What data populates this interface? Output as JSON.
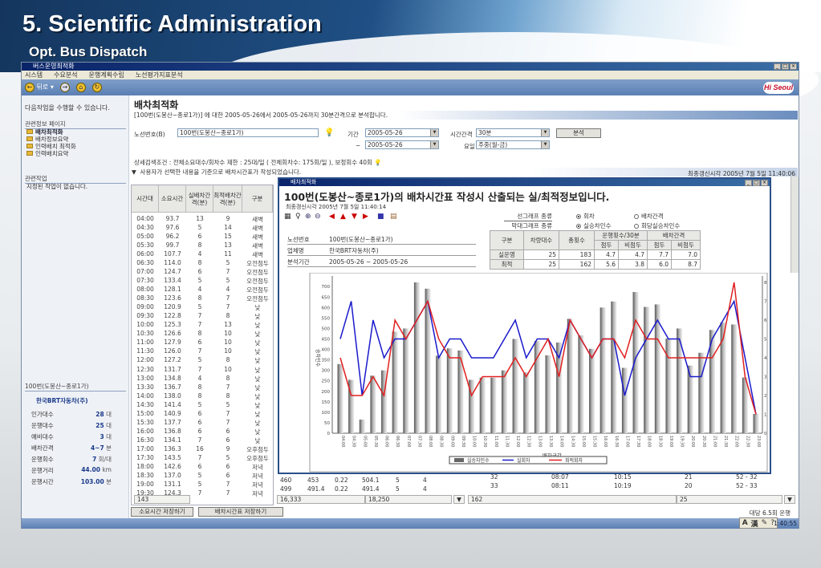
{
  "slide": {
    "title": "5. Scientific Administration",
    "subtitle": "Opt.  Bus Dispatch"
  },
  "window": {
    "title": "버스운영최적화",
    "menu": [
      "시스템",
      "수요분석",
      "운행계획수립",
      "노선평가지표분석"
    ],
    "toolbar": {
      "back": "뒤로"
    },
    "logo": "Hi Seoul"
  },
  "left_panel": {
    "prompt": "다음작업을 수행할 수 있습니다.",
    "related_pages_header": "관련정보 페이지",
    "related_pages": [
      "배차최적화",
      "배차정보요약",
      "인력배치 최적화",
      "인력배치요약"
    ],
    "related_tasks_header": "관련작업",
    "related_tasks_text": "지정된 작업이 없습니다.",
    "route": "100번(도봉산~종로1가)",
    "company": "한국BRT자동차(주)",
    "stats": [
      {
        "label": "인가대수",
        "value": "28",
        "unit": "대"
      },
      {
        "label": "운행대수",
        "value": "25",
        "unit": "대"
      },
      {
        "label": "예비대수",
        "value": "3",
        "unit": "대"
      },
      {
        "label": "배차간격",
        "value": "4~7",
        "unit": "분"
      },
      {
        "label": "운행회수",
        "value": "7",
        "unit": "회/대"
      },
      {
        "label": "운행거리",
        "value": "44.00",
        "unit": "km"
      },
      {
        "label": "운행시간",
        "value": "103.00",
        "unit": "분"
      }
    ]
  },
  "main": {
    "title": "배차최적화",
    "description": "[100번(도봉산~종로1가)] 에 대한 2005-05-26에서 2005-05-26까지 30분간격으로 분석합니다.",
    "route_label": "노선번호(B)",
    "route_value": "100번(도봉산~종로1가)",
    "period_label": "기간",
    "period_from": "2005-05-26",
    "tilde": "~",
    "period_to": "2005-05-26",
    "interval_label": "시간간격",
    "interval_value": "30분",
    "day_label": "요일",
    "day_value": "주중(월-금)",
    "analyze_button": "분석",
    "conditions": "상세검색조건 :  전체소요대수/회차수 제한 : 25대/일 ( 전체회차수: 175회/일 ), 보정회수 40회",
    "notice": "사용자가 선택한 내용을 기준으로 배차시간표가 작성되었습니다.",
    "last_update": "최종갱신시각  2005년 7월 5일 11:40:06",
    "table": {
      "headers": [
        "시간대",
        "소요시간",
        "실배차간격(분)",
        "최적배차간격(분)",
        "구분"
      ],
      "rows": [
        [
          "04:00",
          "93.7",
          "13",
          "9",
          "새벽"
        ],
        [
          "04:30",
          "97.6",
          "5",
          "14",
          "새벽"
        ],
        [
          "05:00",
          "96.2",
          "6",
          "15",
          "새벽"
        ],
        [
          "05:30",
          "99.7",
          "8",
          "13",
          "새벽"
        ],
        [
          "06:00",
          "107.7",
          "4",
          "11",
          "새벽"
        ],
        [
          "06:30",
          "114.0",
          "8",
          "5",
          "오전첨두"
        ],
        [
          "07:00",
          "124.7",
          "6",
          "7",
          "오전첨두"
        ],
        [
          "07:30",
          "133.4",
          "5",
          "5",
          "오전첨두"
        ],
        [
          "08:00",
          "128.1",
          "4",
          "4",
          "오전첨두"
        ],
        [
          "08:30",
          "123.6",
          "8",
          "7",
          "오전첨두"
        ],
        [
          "09:00",
          "120.9",
          "5",
          "7",
          "낮"
        ],
        [
          "09:30",
          "122.8",
          "7",
          "8",
          "낮"
        ],
        [
          "10:00",
          "125.3",
          "7",
          "13",
          "낮"
        ],
        [
          "10:30",
          "126.6",
          "8",
          "10",
          "낮"
        ],
        [
          "11:00",
          "127.9",
          "6",
          "10",
          "낮"
        ],
        [
          "11:30",
          "126.0",
          "7",
          "10",
          "낮"
        ],
        [
          "12:00",
          "127.2",
          "5",
          "8",
          "낮"
        ],
        [
          "12:30",
          "131.7",
          "7",
          "10",
          "낮"
        ],
        [
          "13:00",
          "134.8",
          "4",
          "8",
          "낮"
        ],
        [
          "13:30",
          "136.7",
          "8",
          "7",
          "낮"
        ],
        [
          "14:00",
          "138.0",
          "8",
          "8",
          "낮"
        ],
        [
          "14:30",
          "141.4",
          "5",
          "5",
          "낮"
        ],
        [
          "15:00",
          "140.9",
          "6",
          "7",
          "낮"
        ],
        [
          "15:30",
          "137.7",
          "6",
          "7",
          "낮"
        ],
        [
          "16:00",
          "136.8",
          "6",
          "6",
          "낮"
        ],
        [
          "16:30",
          "134.1",
          "7",
          "6",
          "낮"
        ],
        [
          "17:00",
          "136.3",
          "16",
          "9",
          "오후첨두"
        ],
        [
          "17:30",
          "143.5",
          "7",
          "5",
          "오후첨두"
        ],
        [
          "18:00",
          "142.6",
          "6",
          "6",
          "저녁"
        ],
        [
          "18:30",
          "137.0",
          "5",
          "6",
          "저녁"
        ],
        [
          "19:00",
          "131.1",
          "5",
          "7",
          "저녁"
        ],
        [
          "19:30",
          "124.3",
          "7",
          "7",
          "저녁"
        ]
      ],
      "total": "143"
    },
    "mid_rows": [
      [
        "460",
        "453",
        "0.22",
        "504.1",
        "5",
        "4"
      ],
      [
        "499",
        "491.4",
        "0.22",
        "491.4",
        "5",
        "4"
      ]
    ],
    "mid_totals": [
      "16,333",
      "18,250"
    ],
    "right_rows": [
      [
        "32",
        "08:07",
        "10:15",
        "21",
        "52 - 32"
      ],
      [
        "33",
        "08:11",
        "10:19",
        "20",
        "52 - 33"
      ]
    ],
    "right_totals": [
      "162",
      "25"
    ],
    "save_time_button": "소요시간 저장하기",
    "save_schedule_button": "배차시간표 저장하기",
    "per_bus": "대당 6.5회 운행"
  },
  "popup": {
    "title": "배차최적화",
    "heading": "100번(도봉산~종로1가)의 배차시간표 작성시 산출되는 실/최적정보입니다.",
    "last_update": "최종갱신시각  2005년 7월 5일 11:40:14",
    "line_graph_label": "선그래프 종류",
    "bar_graph_label": "막대그래프 종류",
    "line_options": [
      {
        "label": "회차",
        "selected": true
      },
      {
        "label": "배차간격",
        "selected": false
      }
    ],
    "bar_options": [
      {
        "label": "실승차인수",
        "selected": true
      },
      {
        "label": "회당실승차인수",
        "selected": false
      }
    ],
    "info": [
      {
        "label": "노선번호",
        "value": "100번(도봉산~종로1가)"
      },
      {
        "label": "업체명",
        "value": "한국BRT자동차(주)"
      },
      {
        "label": "분석기간",
        "value": "2005-05-26 ~ 2005-05-26"
      }
    ],
    "stats_headers": {
      "type": "구분",
      "vehicles": "차량대수",
      "total": "총횟수",
      "runs": "운행횟수/30분",
      "interval": "배차간격",
      "peak": "첨두",
      "offpeak": "비첨두"
    },
    "stats_rows": [
      [
        "실운영",
        "25",
        "183",
        "4.7",
        "4.7",
        "7.7",
        "7.0"
      ],
      [
        "최적",
        "25",
        "162",
        "5.6",
        "3.8",
        "6.0",
        "8.7"
      ]
    ]
  },
  "chart_data": {
    "type": "bar+line",
    "xlabel": "배차구간",
    "ylabel": "승차인수",
    "y2label": "회차",
    "ylim": [
      0,
      720
    ],
    "y2lim": [
      0,
      8
    ],
    "yticks": [
      0,
      50,
      100,
      150,
      200,
      250,
      300,
      350,
      400,
      450,
      500,
      550,
      600,
      650,
      700
    ],
    "y2ticks": [
      0,
      1,
      2,
      3,
      4,
      5,
      6,
      7,
      8
    ],
    "categories": [
      "04:00",
      "04:30",
      "05:00",
      "05:30",
      "06:00",
      "06:30",
      "07:00",
      "07:30",
      "08:00",
      "08:30",
      "09:00",
      "09:30",
      "10:00",
      "10:30",
      "11:00",
      "11:30",
      "12:00",
      "12:30",
      "13:00",
      "13:30",
      "14:00",
      "14:30",
      "15:00",
      "15:30",
      "16:00",
      "16:30",
      "17:00",
      "17:30",
      "18:00",
      "18:30",
      "19:00",
      "19:30",
      "20:00",
      "20:30",
      "21:00",
      "21:30",
      "22:00",
      "22:30",
      "23:00"
    ],
    "series": [
      {
        "name": "실승차인수",
        "type": "bar",
        "axis": "left",
        "color": "#8a8a8a",
        "values": [
          330,
          255,
          65,
          275,
          300,
          485,
          500,
          720,
          690,
          370,
          405,
          395,
          255,
          265,
          265,
          300,
          450,
          290,
          440,
          372,
          433,
          546,
          467,
          403,
          600,
          629,
          312,
          674,
          603,
          615,
          452,
          500,
          323,
          384,
          493,
          529,
          519,
          266,
          92
        ]
      },
      {
        "name": "실회차",
        "type": "line",
        "axis": "right",
        "color": "#1a1acc",
        "values": [
          5,
          7,
          2,
          6,
          4,
          5,
          5,
          6,
          7,
          4,
          5,
          5,
          4,
          4,
          4,
          5,
          6,
          4,
          5,
          5,
          4,
          6,
          5,
          4,
          5,
          5,
          2,
          4,
          5,
          6,
          5,
          5,
          3,
          3,
          5,
          6,
          7,
          4,
          1
        ]
      },
      {
        "name": "최적회차",
        "type": "line",
        "axis": "right",
        "color": "#e02020",
        "values": [
          4,
          2,
          2,
          3,
          2,
          6,
          5,
          6,
          7,
          5,
          4,
          4,
          2,
          3,
          3,
          3,
          4,
          3,
          4,
          5,
          3,
          6,
          5,
          4,
          5,
          5,
          4,
          6,
          5,
          5,
          4,
          4,
          4,
          4,
          4,
          5,
          8,
          3,
          1
        ]
      }
    ],
    "legend": "bottom"
  },
  "taskbar": {
    "ime": [
      "A",
      "漢"
    ],
    "clock": "1:40:55"
  }
}
